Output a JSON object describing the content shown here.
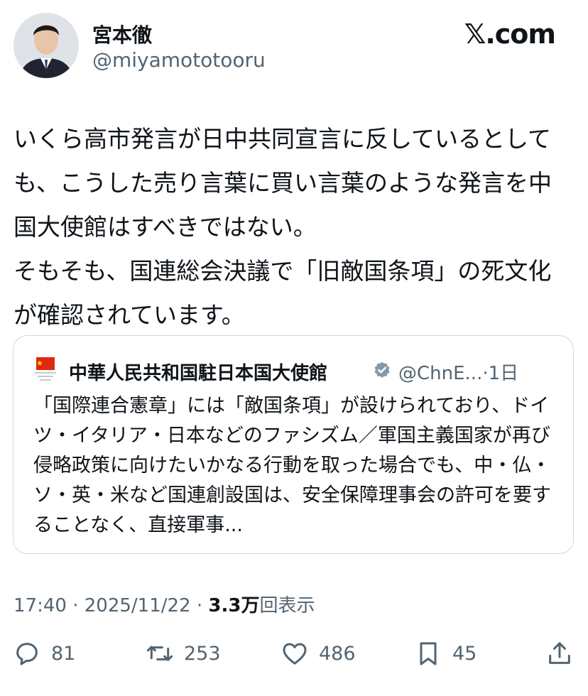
{
  "author": {
    "name": "宮本徹",
    "handle": "@miyamototooru"
  },
  "brand": "𝕏.com",
  "post_text": "いくら高市発言が日中共同宣言に反しているとしても、こうした売り言葉に買い言葉のような発言を中国大使館はすべきではない。\nそもそも、国連総会決議で「旧敵国条項」の死文化が確認されています。",
  "quote": {
    "author_name": "中華人民共和国駐日本国大使館",
    "author_handle": "@ChnE...",
    "time": "·1日",
    "text": "「国際連合憲章」には「敵国条項」が設けられており、ドイツ・イタリア・日本などのファシズム／軍国主義国家が再び侵略政策に向けたいかなる行動を取った場合でも、中・仏・ソ・英・米など国連創設国は、安全保障理事会の許可を要することなく、直接軍事..."
  },
  "meta": {
    "time": "17:40",
    "sep1": " · ",
    "date": "2025/11/22",
    "sep2": " · ",
    "views": "3.3万",
    "views_label": "回表示"
  },
  "actions": {
    "replies": "81",
    "reposts": "253",
    "likes": "486",
    "bookmarks": "45"
  },
  "colors": {
    "text": "#0f1419",
    "secondary": "#536471",
    "border": "#cfd9de",
    "verified": "#829aab"
  },
  "icons": [
    "avatar",
    "china-flag-icon",
    "verified-badge-icon",
    "reply-icon",
    "repost-icon",
    "like-icon",
    "bookmark-icon",
    "share-icon"
  ]
}
